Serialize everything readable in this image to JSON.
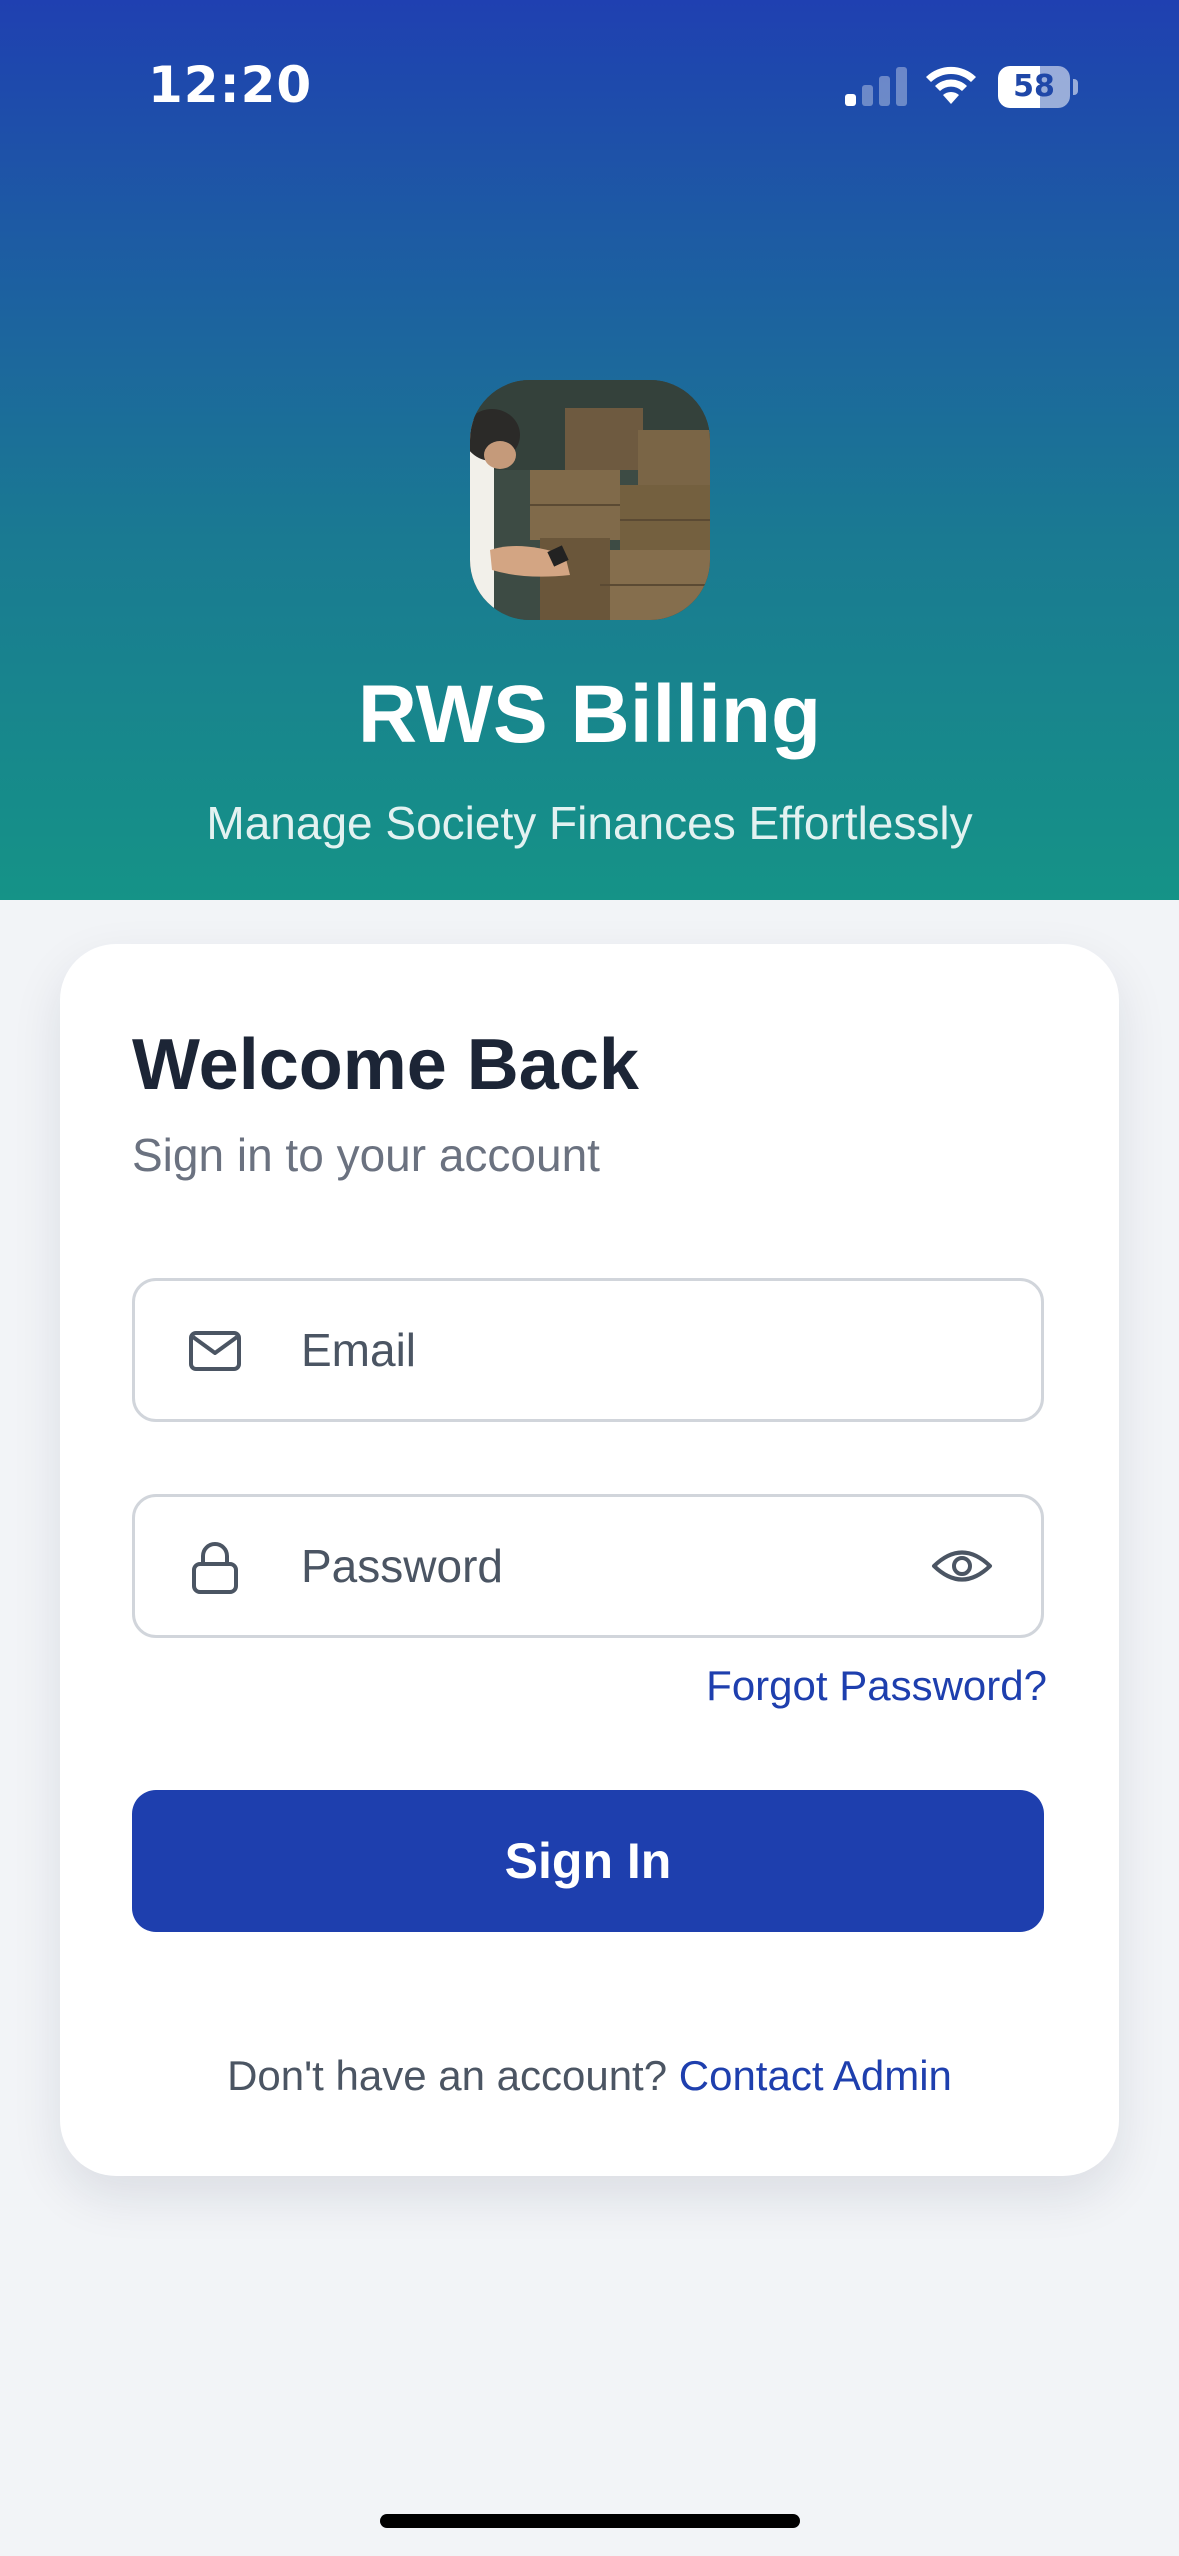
{
  "status_bar": {
    "time": "12:20",
    "battery_percent": "58",
    "battery_level": 0.58,
    "signal_bars_active": 1,
    "signal_bars_total": 4
  },
  "header": {
    "app_title": "RWS Billing",
    "tagline": "Manage Society Finances Effortlessly",
    "logo_icon": "app-logo-boxes-photo"
  },
  "login": {
    "title": "Welcome Back",
    "subtitle": "Sign in to your account",
    "email_placeholder": "Email",
    "email_value": "",
    "password_placeholder": "Password",
    "password_value": "",
    "forgot_label": "Forgot Password?",
    "signin_label": "Sign In",
    "footer_text": "Don't have an account? ",
    "contact_label": "Contact Admin"
  },
  "colors": {
    "brand_blue": "#1e3fae",
    "gradient_top": "#1f40b1",
    "gradient_bottom": "#159387",
    "background": "#f2f4f7"
  },
  "icons": {
    "email": "mail-icon",
    "password": "lock-icon",
    "toggle_visibility": "eye-icon",
    "signal": "signal-icon",
    "wifi": "wifi-icon",
    "battery": "battery-icon"
  }
}
